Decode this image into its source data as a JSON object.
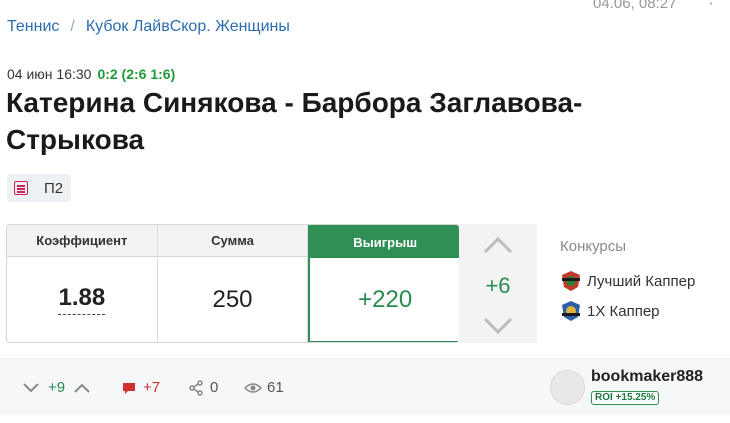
{
  "breadcrumb": [
    "Теннис",
    "Кубок ЛайвСкор. Женщины"
  ],
  "timestamp": "04.06, 08:27",
  "match": {
    "date": "04 июн 16:30",
    "score": "0:2 (2:6 1:6)",
    "title": "Катерина Синякова - Барбора Заглавова-Стрыкова"
  },
  "pick": {
    "label": "П2",
    "icon": "list-icon"
  },
  "bet": {
    "coef_header": "Коэффициент",
    "sum_header": "Сумма",
    "win_header": "Выигрыш",
    "coef": "1.88",
    "sum": "250",
    "win": "+220"
  },
  "votes": {
    "value": "+6"
  },
  "contests": {
    "header": "Конкурсы",
    "items": [
      "Лучший Каппер",
      "1X Каппер"
    ]
  },
  "footer": {
    "rating": "+9",
    "comments": "+7",
    "shares": "0",
    "views": "61",
    "author": "bookmaker888",
    "roi": "ROI +15.25%"
  },
  "colors": {
    "accent": "#2f8f55",
    "link": "#2b6db0",
    "comment": "#d03030"
  }
}
